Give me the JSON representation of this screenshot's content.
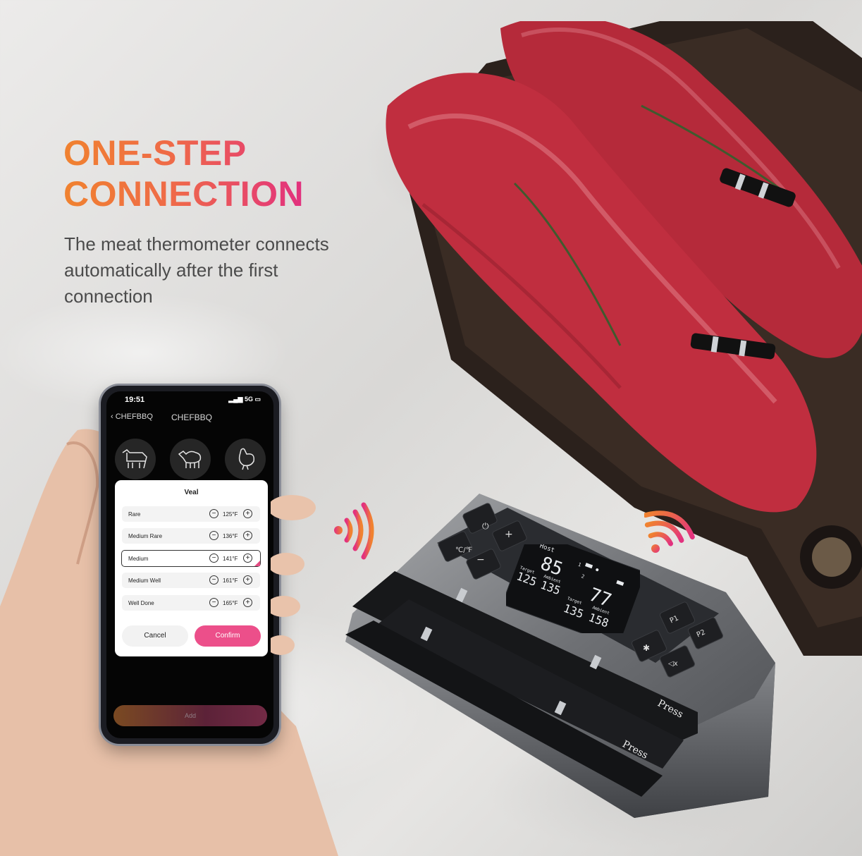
{
  "headline": {
    "line1": "ONE-STEP",
    "line2": "CONNECTION"
  },
  "subtitle": "The meat thermometer connects automatically after the first connection",
  "phone": {
    "time": "19:51",
    "network": "5G",
    "back_label": "CHEFBBQ",
    "title": "CHEFBBQ",
    "animals": [
      "cow-icon",
      "sheep-icon",
      "chicken-icon"
    ],
    "modal": {
      "title": "Veal",
      "options": [
        {
          "label": "Rare",
          "value": "125°F",
          "selected": false
        },
        {
          "label": "Medium Rare",
          "value": "136°F",
          "selected": false
        },
        {
          "label": "Medium",
          "value": "141°F",
          "selected": true
        },
        {
          "label": "Medium Well",
          "value": "161°F",
          "selected": false
        },
        {
          "label": "Well Done",
          "value": "165°F",
          "selected": false
        }
      ],
      "cancel": "Cancel",
      "confirm": "Confirm"
    },
    "add": "Add"
  },
  "device": {
    "buttons": {
      "power": "⏻",
      "plus": "+",
      "unit": "℃/℉",
      "minus": "−",
      "p1": "P1",
      "p2": "P2",
      "settings": "✱",
      "mute": "◁x"
    },
    "lcd": {
      "host": "Host",
      "probe1": {
        "temp": "85",
        "target_label": "Target",
        "target": "125",
        "ambient_label": "Ambient",
        "ambient": "135",
        "index": "1"
      },
      "probe2": {
        "temp": "77",
        "target_label": "Target",
        "target": "135",
        "ambient_label": "Ambient",
        "ambient": "158",
        "index": "2"
      }
    },
    "press1": "Press",
    "press2": "Press"
  },
  "colors": {
    "accent_orange": "#f0822f",
    "accent_pink": "#e2317f",
    "confirm": "#ec4f8a"
  }
}
